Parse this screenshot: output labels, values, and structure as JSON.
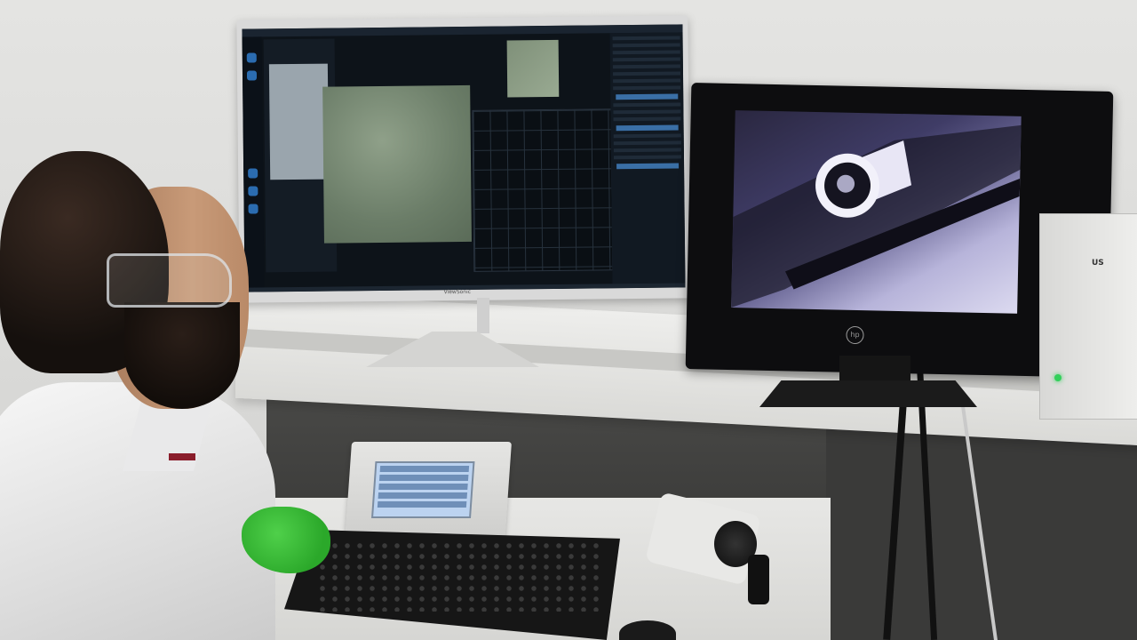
{
  "scene": {
    "left_monitor_brand": "ViewSonic",
    "right_monitor_brand": "hp",
    "instrument_label": "US"
  },
  "colors": {
    "glove": "#3cbf38",
    "status_led": "#32d05a",
    "screen_ui_accent": "#2b6cb0",
    "right_screen_tint": "#8a86c0"
  },
  "icons": [
    "hp-logo-icon",
    "power-led-icon"
  ]
}
